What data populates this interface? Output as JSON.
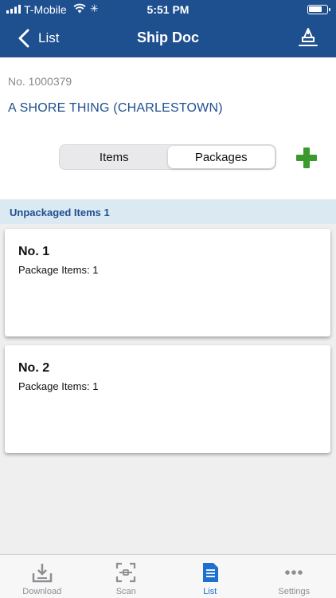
{
  "status_bar": {
    "carrier": "T-Mobile",
    "time": "5:51 PM"
  },
  "nav": {
    "back_label": "List",
    "title": "Ship Doc"
  },
  "document": {
    "number": "No.  1000379",
    "customer": "A SHORE THING (CHARLESTOWN)"
  },
  "segments": {
    "items_label": "Items",
    "packages_label": "Packages",
    "selected": "Packages"
  },
  "section": {
    "label": "Unpackaged Items 1"
  },
  "packages": [
    {
      "title": "No. 1",
      "subtitle": "Package Items: 1"
    },
    {
      "title": "No. 2",
      "subtitle": "Package Items: 1"
    }
  ],
  "tabs": [
    {
      "label": "Download",
      "icon": "download-tray-icon"
    },
    {
      "label": "Scan",
      "icon": "scan-icon"
    },
    {
      "label": "List",
      "icon": "document-list-icon"
    },
    {
      "label": "Settings",
      "icon": "more-dots-icon"
    }
  ],
  "colors": {
    "nav_blue": "#1e4f8f",
    "add_green": "#3a9a2e",
    "active_tab": "#1e6fd0",
    "section_bg": "#dbe9f3"
  }
}
